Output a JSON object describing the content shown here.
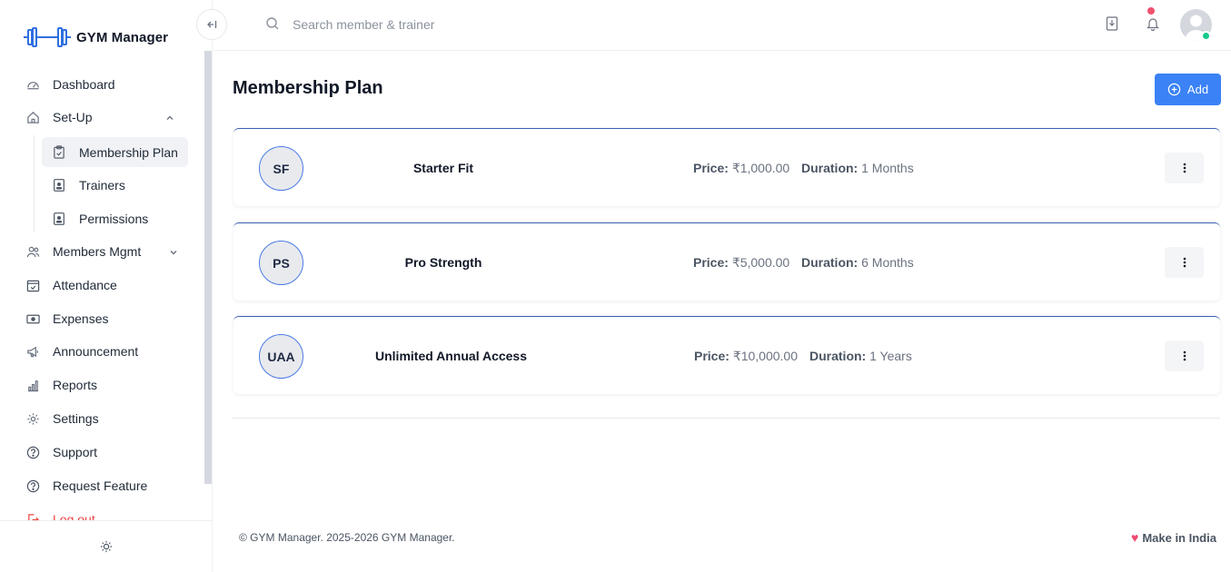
{
  "app": {
    "title": "GYM Manager"
  },
  "sidebar": {
    "items": [
      {
        "label": "Dashboard",
        "icon": "gauge-icon"
      },
      {
        "label": "Set-Up",
        "icon": "home-icon"
      },
      {
        "label": "Members Mgmt",
        "icon": "users-icon"
      },
      {
        "label": "Attendance",
        "icon": "calendar-check-icon"
      },
      {
        "label": "Expenses",
        "icon": "cash-icon"
      },
      {
        "label": "Announcement",
        "icon": "megaphone-icon"
      },
      {
        "label": "Reports",
        "icon": "bar-chart-icon"
      },
      {
        "label": "Settings",
        "icon": "gear-icon"
      },
      {
        "label": "Support",
        "icon": "help-circle-icon"
      },
      {
        "label": "Request Feature",
        "icon": "help-circle-icon"
      },
      {
        "label": "Log out",
        "icon": "logout-icon"
      }
    ],
    "setup_children": [
      {
        "label": "Membership Plan",
        "icon": "clipboard-icon",
        "active": true
      },
      {
        "label": "Trainers",
        "icon": "id-badge-icon"
      },
      {
        "label": "Permissions",
        "icon": "id-badge-icon"
      }
    ]
  },
  "header": {
    "search_placeholder": "Search member & trainer"
  },
  "main": {
    "title": "Membership Plan",
    "add_label": "Add",
    "plans": [
      {
        "initials": "SF",
        "name": "Starter Fit",
        "price_label": "Price:",
        "price": "₹1,000.00",
        "duration_label": "Duration:",
        "duration": "1 Months"
      },
      {
        "initials": "PS",
        "name": "Pro Strength",
        "price_label": "Price:",
        "price": "₹5,000.00",
        "duration_label": "Duration:",
        "duration": "6 Months"
      },
      {
        "initials": "UAA",
        "name": "Unlimited Annual Access",
        "price_label": "Price:",
        "price": "₹10,000.00",
        "duration_label": "Duration:",
        "duration": "1 Years"
      }
    ]
  },
  "footer": {
    "copyright": "© GYM Manager. 2025-2026 GYM Manager.",
    "made_in": "Make in India"
  },
  "colors": {
    "accent": "#3b82f6",
    "notification": "#f0506e",
    "online": "#17c98a"
  }
}
